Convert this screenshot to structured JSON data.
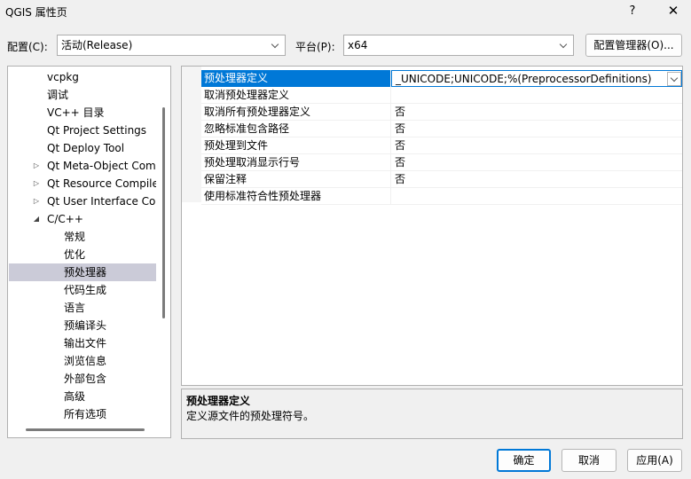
{
  "window": {
    "title": "QGIS 属性页",
    "help_label": "?",
    "close_label": "✕"
  },
  "config": {
    "label": "配置(C):",
    "value": "活动(Release)",
    "platform_label": "平台(P):",
    "platform_value": "x64",
    "manager_button": "配置管理器(O)..."
  },
  "tree": {
    "items": [
      {
        "label": "vcpkg",
        "expander": ""
      },
      {
        "label": "调试",
        "expander": ""
      },
      {
        "label": "VC++ 目录",
        "expander": ""
      },
      {
        "label": "Qt Project Settings",
        "expander": ""
      },
      {
        "label": "Qt Deploy Tool",
        "expander": ""
      },
      {
        "label": "Qt Meta-Object Com",
        "expander": "▷"
      },
      {
        "label": "Qt Resource Compile",
        "expander": "▷"
      },
      {
        "label": "Qt User Interface Co",
        "expander": "▷"
      },
      {
        "label": "C/C++",
        "expander": "◢"
      },
      {
        "label": "常规",
        "expander": ""
      },
      {
        "label": "优化",
        "expander": ""
      },
      {
        "label": "预处理器",
        "expander": "",
        "selected": true
      },
      {
        "label": "代码生成",
        "expander": ""
      },
      {
        "label": "语言",
        "expander": ""
      },
      {
        "label": "预编译头",
        "expander": ""
      },
      {
        "label": "输出文件",
        "expander": ""
      },
      {
        "label": "浏览信息",
        "expander": ""
      },
      {
        "label": "外部包含",
        "expander": ""
      },
      {
        "label": "高级",
        "expander": ""
      },
      {
        "label": "所有选项",
        "expander": ""
      }
    ]
  },
  "grid": {
    "rows": [
      {
        "name": "预处理器定义",
        "value": "_UNICODE;UNICODE;%(PreprocessorDefinitions)",
        "selected": true
      },
      {
        "name": "取消预处理器定义",
        "value": ""
      },
      {
        "name": "取消所有预处理器定义",
        "value": "否"
      },
      {
        "name": "忽略标准包含路径",
        "value": "否"
      },
      {
        "name": "预处理到文件",
        "value": "否"
      },
      {
        "name": "预处理取消显示行号",
        "value": "否"
      },
      {
        "name": "保留注释",
        "value": "否"
      },
      {
        "name": "使用标准符合性预处理器",
        "value": ""
      }
    ]
  },
  "description": {
    "title": "预处理器定义",
    "text": "定义源文件的预处理符号。"
  },
  "buttons": {
    "ok": "确定",
    "cancel": "取消",
    "apply": "应用(A)"
  }
}
